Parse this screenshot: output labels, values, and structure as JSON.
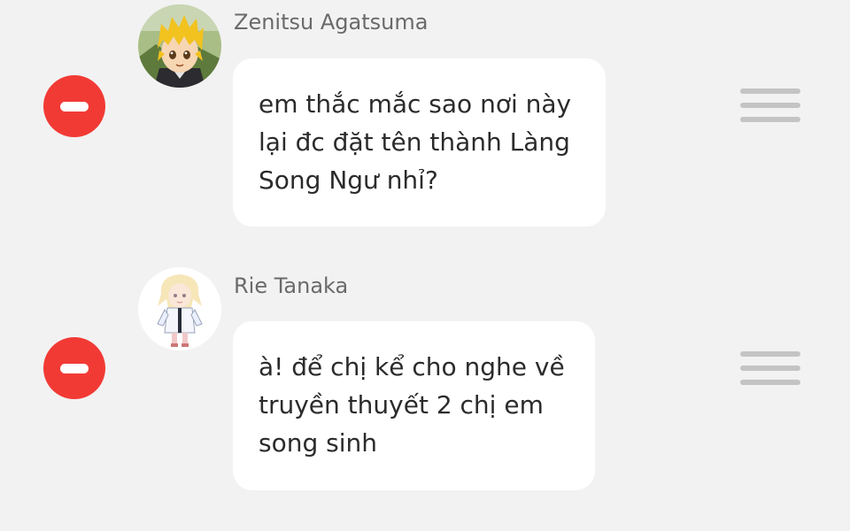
{
  "messages": [
    {
      "sender": "Zenitsu Agatsuma",
      "avatar_icon": "zenitsu-avatar",
      "text": "em thắc mắc sao nơi này\nlại đc đặt tên thành Làng\nSong Ngư nhỉ?",
      "delete_icon": "minus-circle-icon",
      "handle_icon": "drag-handle-icon"
    },
    {
      "sender": "Rie Tanaka",
      "avatar_icon": "rie-avatar",
      "text": "à! để chị kể cho nghe về\ntruyền thuyết 2 chị em\nsong sinh",
      "delete_icon": "minus-circle-icon",
      "handle_icon": "drag-handle-icon"
    }
  ],
  "colors": {
    "background": "#f2f2f2",
    "delete": "#f23a35",
    "bubble": "#ffffff",
    "sender_text": "#6a6a6a",
    "message_text": "#2b2b2b",
    "handle": "#c4c4c4"
  }
}
